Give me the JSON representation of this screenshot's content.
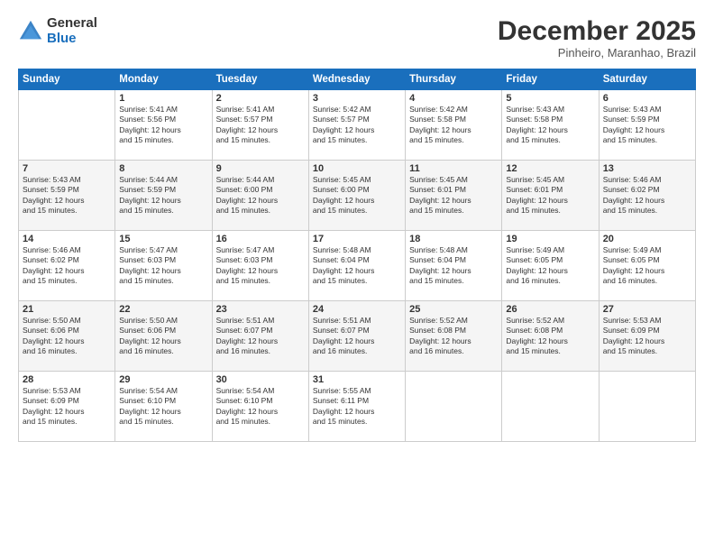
{
  "logo": {
    "general": "General",
    "blue": "Blue"
  },
  "title": "December 2025",
  "subtitle": "Pinheiro, Maranhao, Brazil",
  "header_days": [
    "Sunday",
    "Monday",
    "Tuesday",
    "Wednesday",
    "Thursday",
    "Friday",
    "Saturday"
  ],
  "weeks": [
    [
      {
        "day": "",
        "info": ""
      },
      {
        "day": "1",
        "info": "Sunrise: 5:41 AM\nSunset: 5:56 PM\nDaylight: 12 hours\nand 15 minutes."
      },
      {
        "day": "2",
        "info": "Sunrise: 5:41 AM\nSunset: 5:57 PM\nDaylight: 12 hours\nand 15 minutes."
      },
      {
        "day": "3",
        "info": "Sunrise: 5:42 AM\nSunset: 5:57 PM\nDaylight: 12 hours\nand 15 minutes."
      },
      {
        "day": "4",
        "info": "Sunrise: 5:42 AM\nSunset: 5:58 PM\nDaylight: 12 hours\nand 15 minutes."
      },
      {
        "day": "5",
        "info": "Sunrise: 5:43 AM\nSunset: 5:58 PM\nDaylight: 12 hours\nand 15 minutes."
      },
      {
        "day": "6",
        "info": "Sunrise: 5:43 AM\nSunset: 5:59 PM\nDaylight: 12 hours\nand 15 minutes."
      }
    ],
    [
      {
        "day": "7",
        "info": "Sunrise: 5:43 AM\nSunset: 5:59 PM\nDaylight: 12 hours\nand 15 minutes."
      },
      {
        "day": "8",
        "info": "Sunrise: 5:44 AM\nSunset: 5:59 PM\nDaylight: 12 hours\nand 15 minutes."
      },
      {
        "day": "9",
        "info": "Sunrise: 5:44 AM\nSunset: 6:00 PM\nDaylight: 12 hours\nand 15 minutes."
      },
      {
        "day": "10",
        "info": "Sunrise: 5:45 AM\nSunset: 6:00 PM\nDaylight: 12 hours\nand 15 minutes."
      },
      {
        "day": "11",
        "info": "Sunrise: 5:45 AM\nSunset: 6:01 PM\nDaylight: 12 hours\nand 15 minutes."
      },
      {
        "day": "12",
        "info": "Sunrise: 5:45 AM\nSunset: 6:01 PM\nDaylight: 12 hours\nand 15 minutes."
      },
      {
        "day": "13",
        "info": "Sunrise: 5:46 AM\nSunset: 6:02 PM\nDaylight: 12 hours\nand 15 minutes."
      }
    ],
    [
      {
        "day": "14",
        "info": "Sunrise: 5:46 AM\nSunset: 6:02 PM\nDaylight: 12 hours\nand 15 minutes."
      },
      {
        "day": "15",
        "info": "Sunrise: 5:47 AM\nSunset: 6:03 PM\nDaylight: 12 hours\nand 15 minutes."
      },
      {
        "day": "16",
        "info": "Sunrise: 5:47 AM\nSunset: 6:03 PM\nDaylight: 12 hours\nand 15 minutes."
      },
      {
        "day": "17",
        "info": "Sunrise: 5:48 AM\nSunset: 6:04 PM\nDaylight: 12 hours\nand 15 minutes."
      },
      {
        "day": "18",
        "info": "Sunrise: 5:48 AM\nSunset: 6:04 PM\nDaylight: 12 hours\nand 15 minutes."
      },
      {
        "day": "19",
        "info": "Sunrise: 5:49 AM\nSunset: 6:05 PM\nDaylight: 12 hours\nand 16 minutes."
      },
      {
        "day": "20",
        "info": "Sunrise: 5:49 AM\nSunset: 6:05 PM\nDaylight: 12 hours\nand 16 minutes."
      }
    ],
    [
      {
        "day": "21",
        "info": "Sunrise: 5:50 AM\nSunset: 6:06 PM\nDaylight: 12 hours\nand 16 minutes."
      },
      {
        "day": "22",
        "info": "Sunrise: 5:50 AM\nSunset: 6:06 PM\nDaylight: 12 hours\nand 16 minutes."
      },
      {
        "day": "23",
        "info": "Sunrise: 5:51 AM\nSunset: 6:07 PM\nDaylight: 12 hours\nand 16 minutes."
      },
      {
        "day": "24",
        "info": "Sunrise: 5:51 AM\nSunset: 6:07 PM\nDaylight: 12 hours\nand 16 minutes."
      },
      {
        "day": "25",
        "info": "Sunrise: 5:52 AM\nSunset: 6:08 PM\nDaylight: 12 hours\nand 16 minutes."
      },
      {
        "day": "26",
        "info": "Sunrise: 5:52 AM\nSunset: 6:08 PM\nDaylight: 12 hours\nand 15 minutes."
      },
      {
        "day": "27",
        "info": "Sunrise: 5:53 AM\nSunset: 6:09 PM\nDaylight: 12 hours\nand 15 minutes."
      }
    ],
    [
      {
        "day": "28",
        "info": "Sunrise: 5:53 AM\nSunset: 6:09 PM\nDaylight: 12 hours\nand 15 minutes."
      },
      {
        "day": "29",
        "info": "Sunrise: 5:54 AM\nSunset: 6:10 PM\nDaylight: 12 hours\nand 15 minutes."
      },
      {
        "day": "30",
        "info": "Sunrise: 5:54 AM\nSunset: 6:10 PM\nDaylight: 12 hours\nand 15 minutes."
      },
      {
        "day": "31",
        "info": "Sunrise: 5:55 AM\nSunset: 6:11 PM\nDaylight: 12 hours\nand 15 minutes."
      },
      {
        "day": "",
        "info": ""
      },
      {
        "day": "",
        "info": ""
      },
      {
        "day": "",
        "info": ""
      }
    ]
  ]
}
